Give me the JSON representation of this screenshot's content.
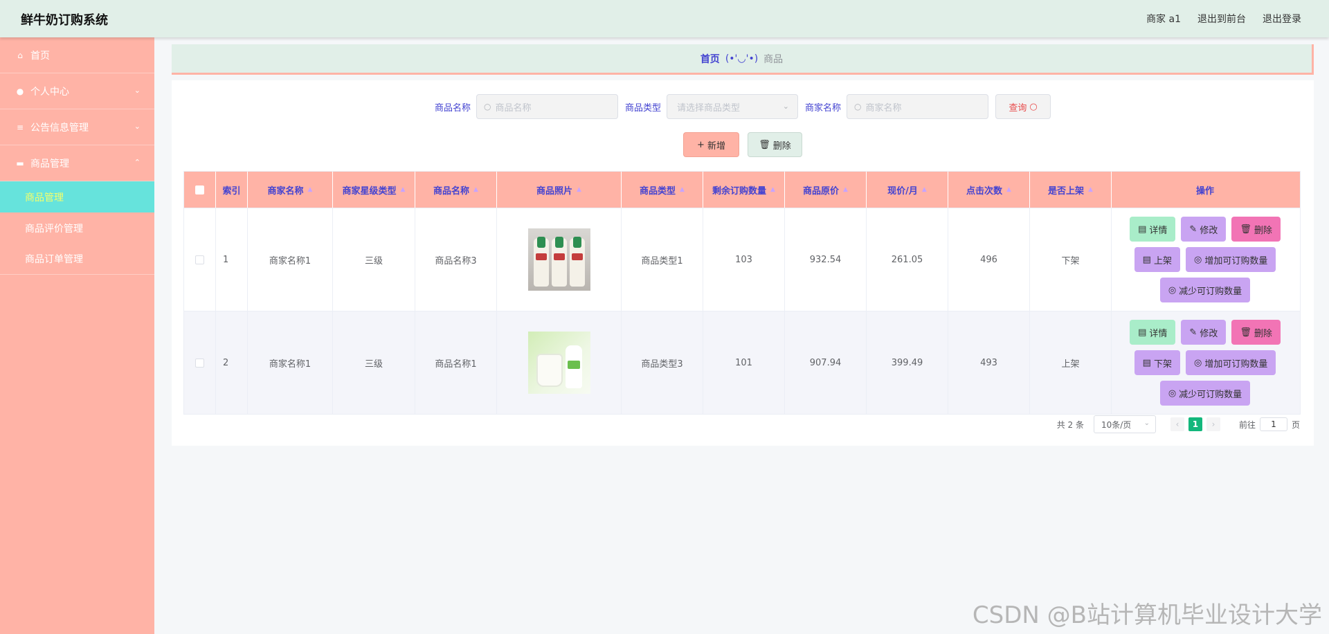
{
  "app": {
    "title": "鲜牛奶订购系统",
    "user": "商家 a1",
    "to_front": "退出到前台",
    "logout": "退出登录"
  },
  "sidebar": {
    "items": [
      {
        "label": "首页",
        "icon": "home-icon"
      },
      {
        "label": "个人中心",
        "icon": "user-icon"
      },
      {
        "label": "公告信息管理",
        "icon": "list-icon"
      },
      {
        "label": "商品管理",
        "icon": "shop-icon"
      }
    ],
    "sub": [
      {
        "label": "商品管理",
        "active": true
      },
      {
        "label": "商品评价管理"
      },
      {
        "label": "商品订单管理"
      }
    ]
  },
  "breadcrumb": {
    "home": "首页",
    "face": "(•'◡'•)",
    "current": "商品"
  },
  "search": {
    "goods_name_label": "商品名称",
    "goods_name_placeholder": "商品名称",
    "goods_type_label": "商品类型",
    "goods_type_placeholder": "请选择商品类型",
    "merchant_label": "商家名称",
    "merchant_placeholder": "商家名称",
    "query_label": "查询"
  },
  "actions": {
    "add": "新增",
    "delete": "删除"
  },
  "table": {
    "headers": [
      "索引",
      "商家名称",
      "商家星级类型",
      "商品名称",
      "商品照片",
      "商品类型",
      "剩余订购数量",
      "商品原价",
      "现价/月",
      "点击次数",
      "是否上架",
      "操作"
    ],
    "rows": [
      {
        "index": "1",
        "merchant": "商家名称1",
        "star": "三级",
        "goods": "商品名称3",
        "type": "商品类型1",
        "remain": "103",
        "orig": "932.54",
        "now": "261.05",
        "clicks": "496",
        "status": "下架",
        "toggle": "上架"
      },
      {
        "index": "2",
        "merchant": "商家名称1",
        "star": "三级",
        "goods": "商品名称1",
        "type": "商品类型3",
        "remain": "101",
        "orig": "907.94",
        "now": "399.49",
        "clicks": "493",
        "status": "上架",
        "toggle": "下架"
      }
    ],
    "ops": {
      "detail": "详情",
      "edit": "修改",
      "delete": "删除",
      "add_qty": "增加可订购数量",
      "dec_qty": "减少可订购数量"
    }
  },
  "pager": {
    "total": "共 2 条",
    "size": "10条/页",
    "page": "1",
    "goto_label": "前往",
    "goto_value": "1",
    "page_suffix": "页"
  },
  "watermark": "CSDN @B站计算机毕业设计大学",
  "colors": {
    "accent": "#ffb3a6",
    "header": "#e1efe8",
    "active_sub": "#66e3dc",
    "text_blue": "#4343d1"
  }
}
